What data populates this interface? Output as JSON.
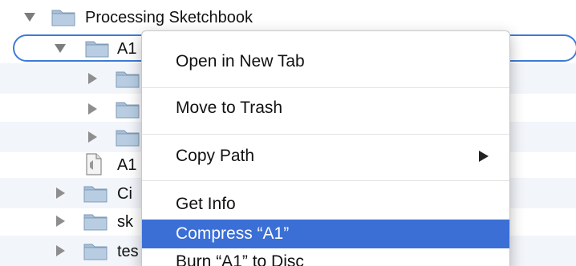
{
  "tree": {
    "root": {
      "label": "Processing Sketchbook",
      "icon": "folder-icon",
      "expanded": true
    },
    "items": [
      {
        "label": "A1",
        "icon": "folder-icon",
        "expanded": true,
        "selected": true
      },
      {
        "label": "",
        "icon": "folder-icon",
        "expanded": false
      },
      {
        "label": "",
        "icon": "folder-icon",
        "expanded": false
      },
      {
        "label": "",
        "icon": "folder-icon",
        "expanded": false
      },
      {
        "label": "A1",
        "icon": "document-icon"
      },
      {
        "label": "Ci",
        "icon": "folder-icon",
        "expanded": false
      },
      {
        "label": "sk",
        "icon": "folder-icon",
        "expanded": false
      },
      {
        "label": "tes",
        "icon": "folder-icon",
        "expanded": false
      }
    ]
  },
  "context_menu": {
    "items": [
      {
        "label": "Open in New Tab"
      },
      {
        "label": "Move to Trash"
      },
      {
        "label": "Copy Path",
        "submenu": true
      },
      {
        "label": "Get Info"
      },
      {
        "label": "Compress “A1”",
        "highlighted": true
      },
      {
        "label": "Burn “A1” to Disc"
      }
    ]
  },
  "colors": {
    "selection": "#3d7bd9",
    "highlight": "#3b6fd6",
    "folder_fill": "#a9bfd6"
  }
}
